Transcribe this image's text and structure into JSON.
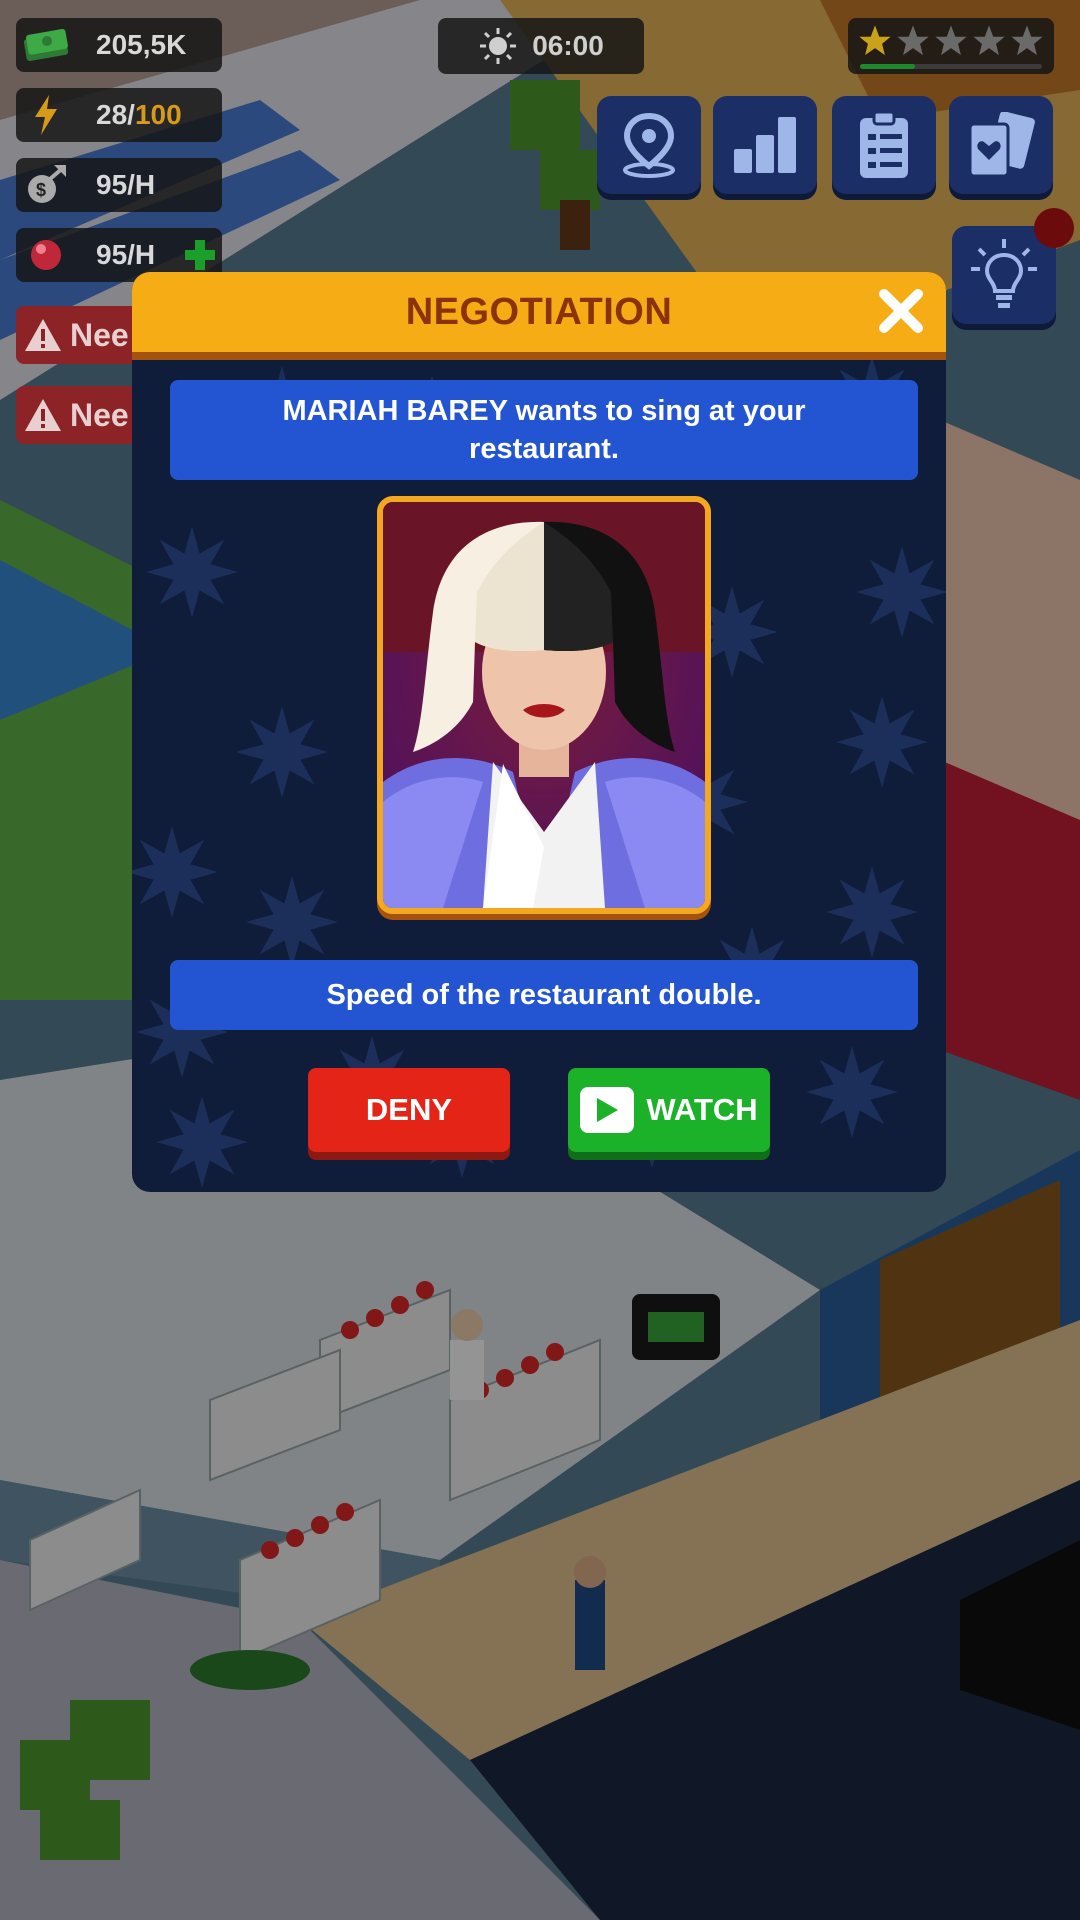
{
  "hud": {
    "money": "205,5K",
    "energy_current": "28/",
    "energy_max": "100",
    "income_rate": "95/H",
    "gem_rate": "95/H",
    "time": "06:00",
    "rating_stars_filled": 1,
    "rating_stars_total": 5,
    "rating_progress": 0.3,
    "warnings": [
      "Nee",
      "Nee"
    ]
  },
  "top_buttons": [
    "map-pin-icon",
    "stats-icon",
    "clipboard-icon",
    "cards-icon"
  ],
  "hint_button": "lightbulb-icon",
  "modal": {
    "title": "NEGOTIATION",
    "offer_text": "MARIAH BAREY wants to sing at your restaurant.",
    "effect_text": "Speed of the restaurant double.",
    "deny_label": "DENY",
    "watch_label": "WATCH"
  },
  "colors": {
    "header": "#f6ac14",
    "title_text": "#8a3208",
    "modal_bg": "#0f1c3a",
    "info_box": "#2355d2",
    "deny": "#e42417",
    "watch": "#1bb229"
  }
}
